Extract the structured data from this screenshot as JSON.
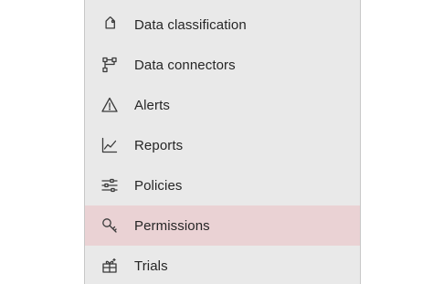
{
  "nav": {
    "items": [
      {
        "label": "Data classification",
        "icon": "tag-icon",
        "selected": false
      },
      {
        "label": "Data connectors",
        "icon": "connector-icon",
        "selected": false
      },
      {
        "label": "Alerts",
        "icon": "warning-icon",
        "selected": false
      },
      {
        "label": "Reports",
        "icon": "line-chart-icon",
        "selected": false
      },
      {
        "label": "Policies",
        "icon": "sliders-icon",
        "selected": false
      },
      {
        "label": "Permissions",
        "icon": "key-icon",
        "selected": true
      },
      {
        "label": "Trials",
        "icon": "gift-icon",
        "selected": false
      }
    ]
  },
  "colors": {
    "panel_background": "#e9e9e9",
    "selected_background": "#ead2d4",
    "text": "#262626"
  }
}
